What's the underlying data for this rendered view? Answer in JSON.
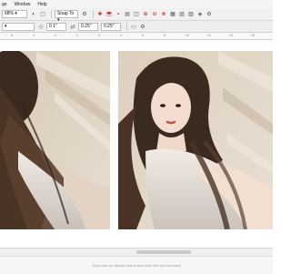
{
  "menubar": {
    "items": [
      "ge",
      "Window",
      "Help"
    ]
  },
  "toolbar": {
    "zoom_value": "68%",
    "snap_label": "Snap To",
    "icons": [
      "new-doc-icon",
      "open-icon",
      "save-icon",
      "print-icon",
      "undo-icon",
      "redo-icon",
      "import-icon",
      "export-icon",
      "pdf-icon",
      "zoom-icon",
      "snap-icon",
      "options-icon",
      "launch-icon",
      "grid-icon",
      "guides-icon",
      "colors-icon",
      "settings-icon"
    ]
  },
  "propbar": {
    "unit_value": "",
    "offset_value": "0.1\"",
    "x_value": "0.25\"",
    "y_value": "0.25\""
  },
  "ruler": {
    "ticks": [
      "6",
      "4",
      "2",
      "0",
      "2",
      "4",
      "6",
      "8",
      "10",
      "12",
      "14",
      "16",
      "18"
    ]
  },
  "statusbar": {
    "hint": "Drag colors (or objects) here to store them with your document"
  }
}
